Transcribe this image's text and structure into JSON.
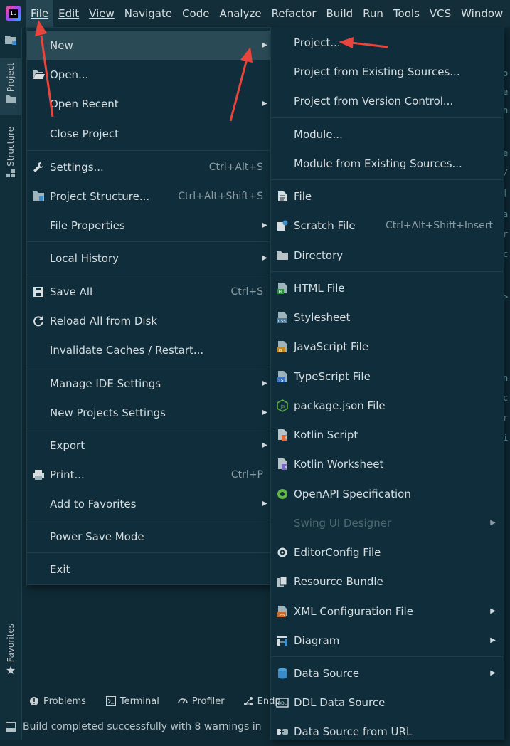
{
  "menubar": {
    "items": [
      {
        "label": "File",
        "active": true
      },
      {
        "label": "Edit"
      },
      {
        "label": "View"
      },
      {
        "label": "Navigate"
      },
      {
        "label": "Code"
      },
      {
        "label": "Analyze"
      },
      {
        "label": "Refactor"
      },
      {
        "label": "Build"
      },
      {
        "label": "Run"
      },
      {
        "label": "Tools"
      },
      {
        "label": "VCS"
      },
      {
        "label": "Window"
      }
    ]
  },
  "left_tabs": {
    "project": "Project",
    "structure": "Structure",
    "favorites": "Favorites"
  },
  "file_menu": {
    "items": [
      {
        "label": "New",
        "submenu": true,
        "highlight": true
      },
      {
        "label": "Open...",
        "icon": "folder-open-icon"
      },
      {
        "label": "Open Recent",
        "submenu": true
      },
      {
        "label": "Close Project"
      },
      {
        "label": "Settings...",
        "shortcut": "Ctrl+Alt+S",
        "icon": "wrench-icon"
      },
      {
        "label": "Project Structure...",
        "shortcut": "Ctrl+Alt+Shift+S",
        "icon": "project-structure-icon"
      },
      {
        "label": "File Properties",
        "submenu": true
      },
      {
        "label": "Local History",
        "submenu": true
      },
      {
        "label": "Save All",
        "shortcut": "Ctrl+S",
        "icon": "save-icon"
      },
      {
        "label": "Reload All from Disk",
        "icon": "reload-icon"
      },
      {
        "label": "Invalidate Caches / Restart..."
      },
      {
        "label": "Manage IDE Settings",
        "submenu": true
      },
      {
        "label": "New Projects Settings",
        "submenu": true
      },
      {
        "label": "Export",
        "submenu": true
      },
      {
        "label": "Print...",
        "shortcut": "Ctrl+P",
        "icon": "print-icon"
      },
      {
        "label": "Add to Favorites",
        "submenu": true
      },
      {
        "label": "Power Save Mode"
      },
      {
        "label": "Exit"
      }
    ]
  },
  "new_menu": {
    "items": [
      {
        "label": "Project..."
      },
      {
        "label": "Project from Existing Sources..."
      },
      {
        "label": "Project from Version Control..."
      },
      {
        "label": "Module..."
      },
      {
        "label": "Module from Existing Sources..."
      },
      {
        "label": "File",
        "icon": "file-icon"
      },
      {
        "label": "Scratch File",
        "shortcut": "Ctrl+Alt+Shift+Insert",
        "icon": "scratch-file-icon"
      },
      {
        "label": "Directory",
        "icon": "directory-icon"
      },
      {
        "label": "HTML File",
        "icon": "html-file-icon"
      },
      {
        "label": "Stylesheet",
        "icon": "css-file-icon"
      },
      {
        "label": "JavaScript File",
        "icon": "js-file-icon"
      },
      {
        "label": "TypeScript File",
        "icon": "ts-file-icon"
      },
      {
        "label": "package.json File",
        "icon": "nodejs-icon"
      },
      {
        "label": "Kotlin Script",
        "icon": "kotlin-script-icon"
      },
      {
        "label": "Kotlin Worksheet",
        "icon": "kotlin-worksheet-icon"
      },
      {
        "label": "OpenAPI Specification",
        "icon": "openapi-icon"
      },
      {
        "label": "Swing UI Designer",
        "submenu": true,
        "disabled": true
      },
      {
        "label": "EditorConfig File",
        "icon": "editorconfig-icon"
      },
      {
        "label": "Resource Bundle",
        "icon": "resource-bundle-icon"
      },
      {
        "label": "XML Configuration File",
        "submenu": true,
        "icon": "xml-icon"
      },
      {
        "label": "Diagram",
        "submenu": true,
        "icon": "diagram-icon"
      },
      {
        "label": "Data Source",
        "submenu": true,
        "icon": "database-icon"
      },
      {
        "label": "DDL Data Source",
        "icon": "ddl-icon"
      },
      {
        "label": "Data Source from URL",
        "icon": "url-datasource-icon"
      }
    ]
  },
  "tool_windows": {
    "problems": "Problems",
    "terminal": "Terminal",
    "profiler": "Profiler",
    "endpoints": "Endp"
  },
  "status_bar": {
    "message": "Build completed successfully with 8 warnings in"
  },
  "colors": {
    "background": "#0f2a35",
    "menu_bg": "#0f2d3a",
    "highlight": "#2a4b56",
    "annotation_arrow": "#e8453c"
  }
}
